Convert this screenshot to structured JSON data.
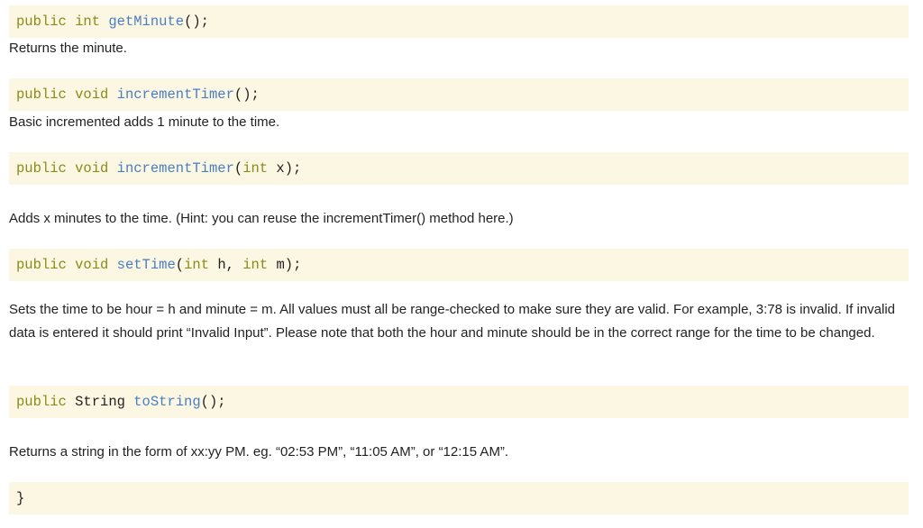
{
  "methods": [
    {
      "code": {
        "mod": "public",
        "type": "int",
        "name": "getMinute",
        "open": "()",
        "close": ";"
      },
      "description": "Returns the minute."
    },
    {
      "code": {
        "mod": "public",
        "type": "void",
        "name": "incrementTimer",
        "open": "()",
        "close": ";"
      },
      "description": "Basic incremented adds 1 minute to the time."
    },
    {
      "code": {
        "mod": "public",
        "type": "void",
        "name": "incrementTimer",
        "p1type": "int",
        "p1name": "x",
        "close": ");"
      },
      "description": "Adds x minutes to the time. (Hint: you can reuse the incrementTimer() method here.)"
    },
    {
      "code": {
        "mod": "public",
        "type": "void",
        "name": "setTime",
        "p1type": "int",
        "p1name": "h,",
        "p2type": "int",
        "p2name": "m",
        "close": ");"
      },
      "description": "Sets the time to be hour = h and minute = m. All values must all be range-checked to make sure they are valid. For example, 3:78 is invalid. If invalid data is entered it should print “Invalid Input”. Please note that both the hour and minute should be in the correct range for the time to be changed."
    },
    {
      "code": {
        "mod": "public",
        "type": "String",
        "name": "toString",
        "open": "()",
        "close": ";"
      },
      "description": "Returns a string in the form of xx:yy PM. eg. “02:53 PM”, “11:05 AM”, or “12:15 AM”."
    }
  ],
  "closing_brace": "}",
  "colors": {
    "code_bg": "#fcf7e2",
    "keyword": "#8b8b19",
    "function": "#4a7ec2",
    "text": "#222222"
  }
}
